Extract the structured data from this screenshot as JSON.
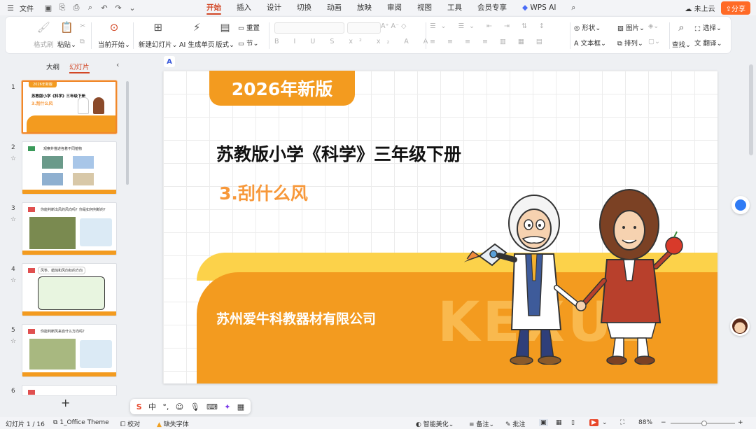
{
  "menubar": {
    "file": "文件",
    "tabs": [
      "开始",
      "插入",
      "设计",
      "切换",
      "动画",
      "放映",
      "审阅",
      "视图",
      "工具",
      "会员专享",
      "WPS AI"
    ],
    "active_tab": "开始",
    "cloud": "未上云",
    "share": "分享"
  },
  "ribbon": {
    "format_painter": "格式刷",
    "paste": "粘贴",
    "from_current": "当前开始",
    "new_slide": "新建幻灯片",
    "ai_page": "AI 生成单页",
    "layout": "版式",
    "reset": "重置",
    "section": "节",
    "shape": "形状",
    "picture": "图片",
    "textbox": "文本框",
    "arrange": "排列",
    "find": "查找",
    "select": "选择",
    "translate": "翻译"
  },
  "leftpanel": {
    "tab_outline": "大纲",
    "tab_slides": "幻灯片",
    "slide_numbers": [
      "1",
      "2",
      "3",
      "4",
      "5",
      "6"
    ],
    "add": "+"
  },
  "thumbs": {
    "t1_edition": "2026年新版",
    "t1_title": "苏教版小学《科学》三年级下册",
    "t1_sub": "3.刮什么风",
    "t2_text": "观察并描述各着不同植物",
    "t3_text": "你能判断出风的风向吗？你是如何判断的？",
    "t4_text": "风筝、蜡烛和风向标的方向",
    "t5_text": "你能判断风来自什么方向吗？"
  },
  "slide": {
    "edition": "2026年新版",
    "title": "苏教版小学《科学》三年级下册",
    "subtitle": "3.刮什么风",
    "company": "苏州爱牛科教器材有限公司",
    "watermark": "KEXUE"
  },
  "minibar": {
    "ime": "中"
  },
  "statusbar": {
    "slide_count": "幻灯片 1 / 16",
    "theme": "1_Office Theme",
    "proofread": "校对",
    "missing_font": "缺失字体",
    "smart_beautify": "智能美化",
    "notes": "备注",
    "comment": "批注",
    "zoom": "88%"
  },
  "colors": {
    "accent": "#d24726",
    "orange": "#f39b1f",
    "subtitle": "#f7983a"
  }
}
